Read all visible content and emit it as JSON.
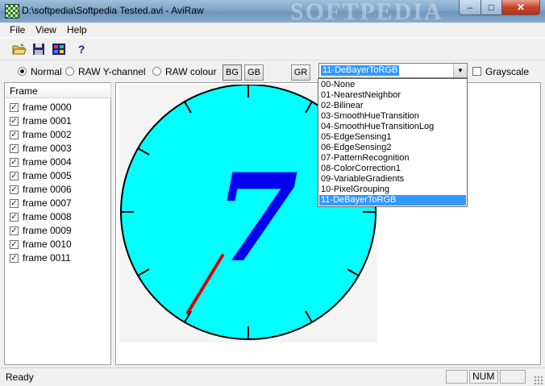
{
  "window": {
    "title": "D:\\softpedia\\Softpedia Tested.avi - AviRaw",
    "watermark": "SOFTPEDIA",
    "controls": {
      "minimize": "‒",
      "maximize": "□",
      "close": "✕"
    }
  },
  "menu": {
    "file": "File",
    "view": "View",
    "help": "Help"
  },
  "toolbar": {
    "icons": [
      "open-folder-icon",
      "save-icon",
      "frames-icon",
      "help-icon"
    ],
    "help_glyph": "?"
  },
  "options": {
    "normal_label": "Normal",
    "raw_y_label": "RAW Y-channel",
    "raw_colour_label": "RAW colour",
    "selected_mode": "Normal",
    "bg_label": "BG",
    "gb_label": "GB",
    "gr_label": "GR",
    "grayscale_label": "Grayscale",
    "grayscale_checked": false
  },
  "debayer": {
    "selected": "11-DeBayerToRGB",
    "arrow": "▼",
    "options": [
      "00-None",
      "01-NearestNeighbor",
      "02-Bilinear",
      "03-SmoothHueTransition",
      "04-SmoothHueTransitionLog",
      "05-EdgeSensing1",
      "06-EdgeSensing2",
      "07-PatternRecognition",
      "08-ColorCorrection1",
      "09-VariableGradients",
      "10-PixelGrouping",
      "11-DeBayerToRGB"
    ]
  },
  "frame_list": {
    "header": "Frame",
    "check_glyph": "✓",
    "frames": [
      "frame 0000",
      "frame 0001",
      "frame 0002",
      "frame 0003",
      "frame 0004",
      "frame 0005",
      "frame 0006",
      "frame 0007",
      "frame 0008",
      "frame 0009",
      "frame 0010",
      "frame 0011"
    ]
  },
  "preview": {
    "digit": "7",
    "dial_color": "#00ffff",
    "digit_color": "#0000ee",
    "hand_color": "#dd0000"
  },
  "statusbar": {
    "status": "Ready",
    "num": "NUM"
  },
  "colors": {
    "selection": "#3399ff",
    "titlebar": "#7fa5c8"
  }
}
